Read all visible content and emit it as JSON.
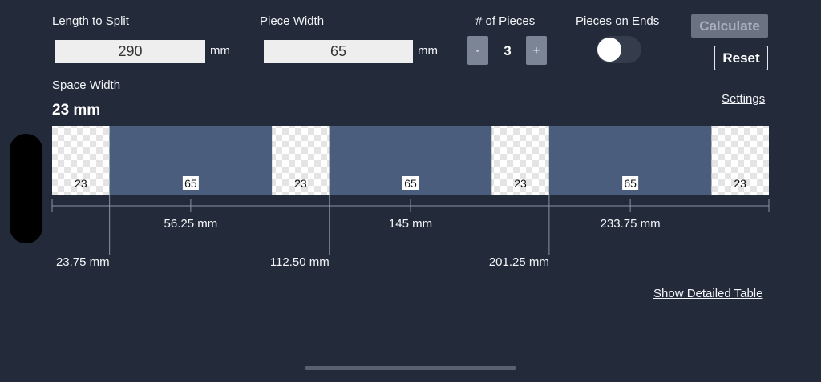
{
  "inputs": {
    "length_label": "Length to Split",
    "length_value": "290",
    "length_unit": "mm",
    "piece_label": "Piece Width",
    "piece_value": "65",
    "piece_unit": "mm"
  },
  "pieces": {
    "label": "# of Pieces",
    "minus": "-",
    "count": "3",
    "plus": "+"
  },
  "ends": {
    "label": "Pieces on Ends",
    "enabled": false
  },
  "actions": {
    "calculate": "Calculate",
    "reset": "Reset"
  },
  "space": {
    "label": "Space Width",
    "value": "23 mm"
  },
  "links": {
    "settings": "Settings",
    "detailed_table": "Show Detailed Table"
  },
  "colors": {
    "background": "#232b3b",
    "piece": "#4b5d7d",
    "calculate_disabled": "#6b7382"
  },
  "layout_diagram": {
    "segments": [
      {
        "type": "space",
        "label": "23"
      },
      {
        "type": "piece",
        "label": "65"
      },
      {
        "type": "space",
        "label": "23"
      },
      {
        "type": "piece",
        "label": "65"
      },
      {
        "type": "space",
        "label": "23"
      },
      {
        "type": "piece",
        "label": "65"
      },
      {
        "type": "space",
        "label": "23"
      }
    ],
    "center_marks": [
      "56.25 mm",
      "145 mm",
      "233.75 mm"
    ],
    "edge_marks": [
      "23.75 mm",
      "112.50 mm",
      "201.25 mm"
    ]
  }
}
